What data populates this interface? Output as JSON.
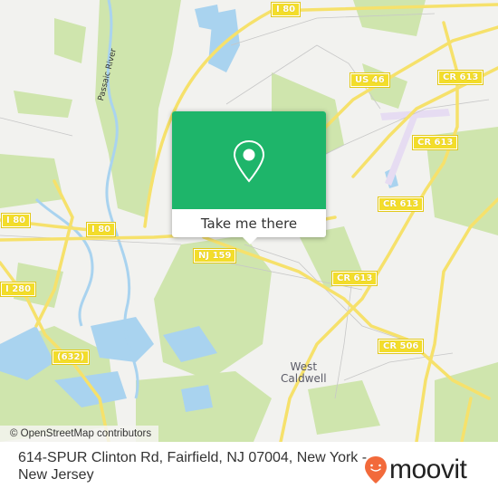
{
  "map": {
    "road_shields": [
      {
        "id": "i80-top",
        "label": "I 80"
      },
      {
        "id": "us46",
        "label": "US 46"
      },
      {
        "id": "cr613-a",
        "label": "CR 613"
      },
      {
        "id": "cr613-b",
        "label": "CR 613"
      },
      {
        "id": "cr613-c",
        "label": "CR 613"
      },
      {
        "id": "cr613-d",
        "label": "CR 613"
      },
      {
        "id": "i80-left",
        "label": "I 80"
      },
      {
        "id": "i80-mid",
        "label": "I 80"
      },
      {
        "id": "nj159",
        "label": "NJ 159"
      },
      {
        "id": "i280",
        "label": "I 280"
      },
      {
        "id": "cr632",
        "label": "(632)"
      },
      {
        "id": "cr506",
        "label": "CR 506"
      }
    ],
    "place_labels": {
      "west_caldwell_line1": "West",
      "west_caldwell_line2": "Caldwell"
    },
    "river_label": "Passaic River",
    "colors": {
      "land": "#f2f2ef",
      "park": "#cfe5ad",
      "water": "#a9d3ef",
      "road": "#f6e16b",
      "airport": "#e6dcf2"
    }
  },
  "popup": {
    "icon": "location-pin-icon",
    "action_label": "Take me there",
    "color": "#1eb56a"
  },
  "attribution": "© OpenStreetMap contributors",
  "footer": {
    "address": "614-SPUR Clinton Rd, Fairfield, NJ 07004, New York - New Jersey",
    "brand": {
      "name": "moovit",
      "icon": "moovit-pin-logo-icon",
      "color": "#f26a3b"
    }
  }
}
